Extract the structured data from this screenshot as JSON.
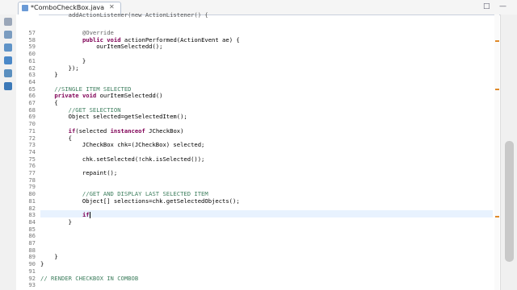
{
  "editor": {
    "tab_title": "*ComboCheckBox.java",
    "tab_close": "✕",
    "maximize": "□",
    "minimize": "—"
  },
  "lines": [
    {
      "n": "57",
      "text": "\t\t\t@Override",
      "cls": "an"
    },
    {
      "n": "58",
      "text": "\t\t\tpublic void actionPerformed(ActionEvent ae) {",
      "cls": ""
    },
    {
      "n": "59",
      "text": "\t\t\t\tourItemSelectedd();",
      "cls": ""
    },
    {
      "n": "60",
      "text": "",
      "cls": ""
    },
    {
      "n": "61",
      "text": "\t\t\t}",
      "cls": ""
    },
    {
      "n": "62",
      "text": "\t\t});",
      "cls": ""
    },
    {
      "n": "63",
      "text": "\t}",
      "cls": ""
    },
    {
      "n": "64",
      "text": "",
      "cls": ""
    },
    {
      "n": "65",
      "text": "\t//SINGLE ITEM SELECTED",
      "cls": "cm"
    },
    {
      "n": "66",
      "text": "\tprivate void ourItemSelectedd()",
      "cls": ""
    },
    {
      "n": "67",
      "text": "\t{",
      "cls": ""
    },
    {
      "n": "68",
      "text": "\t\t//GET SELECTION",
      "cls": "cm"
    },
    {
      "n": "69",
      "text": "\t\tObject selected=getSelectedItem();",
      "cls": ""
    },
    {
      "n": "70",
      "text": "",
      "cls": ""
    },
    {
      "n": "71",
      "text": "\t\tif(selected instanceof JCheckBox)",
      "cls": ""
    },
    {
      "n": "72",
      "text": "\t\t{",
      "cls": ""
    },
    {
      "n": "73",
      "text": "\t\t\tJCheckBox chk=(JCheckBox) selected;",
      "cls": ""
    },
    {
      "n": "74",
      "text": "",
      "cls": ""
    },
    {
      "n": "75",
      "text": "\t\t\tchk.setSelected(!chk.isSelected());",
      "cls": ""
    },
    {
      "n": "76",
      "text": "",
      "cls": ""
    },
    {
      "n": "77",
      "text": "\t\t\trepaint();",
      "cls": ""
    },
    {
      "n": "78",
      "text": "",
      "cls": ""
    },
    {
      "n": "79",
      "text": "",
      "cls": ""
    },
    {
      "n": "80",
      "text": "\t\t\t//GET AND DISPLAY LAST SELECTED ITEM",
      "cls": "cm"
    },
    {
      "n": "81",
      "text": "\t\t\tObject[] selections=chk.getSelectedObjects();",
      "cls": ""
    },
    {
      "n": "82",
      "text": "",
      "cls": ""
    },
    {
      "n": "83",
      "text": "\t\t\tif",
      "cls": "",
      "caret": true
    },
    {
      "n": "84",
      "text": "\t\t}",
      "cls": ""
    },
    {
      "n": "85",
      "text": "",
      "cls": ""
    },
    {
      "n": "86",
      "text": "",
      "cls": ""
    },
    {
      "n": "87",
      "text": "",
      "cls": ""
    },
    {
      "n": "88",
      "text": "",
      "cls": ""
    },
    {
      "n": "89",
      "text": "\t}",
      "cls": ""
    },
    {
      "n": "90",
      "text": "}",
      "cls": ""
    },
    {
      "n": "91",
      "text": "",
      "cls": ""
    },
    {
      "n": "92",
      "text": "// RENDER CHECKBOX IN COMBOB",
      "cls": "cm"
    },
    {
      "n": "93",
      "text": "",
      "cls": ""
    }
  ],
  "partial_top_line": "\t\taddActionListener(new ActionListener() {",
  "colors": {
    "keyword": "#7f0055",
    "comment": "#3f7f5f",
    "annotation": "#646464"
  }
}
